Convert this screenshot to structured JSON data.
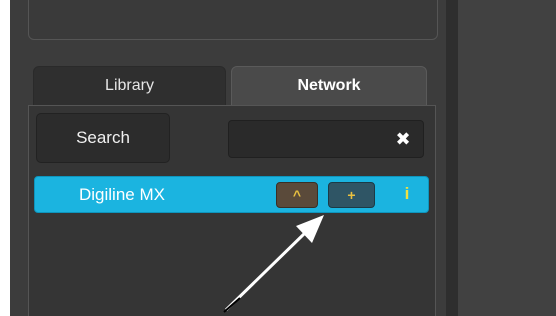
{
  "tabs": {
    "library_label": "Library",
    "network_label": "Network",
    "active": "Network"
  },
  "search": {
    "button_label": "Search",
    "input_value": "",
    "clear_glyph": "✖"
  },
  "devices": [
    {
      "name": "Digiline MX",
      "selected": true,
      "up_label": "^",
      "add_label": "+",
      "info_label": "i"
    }
  ],
  "colors": {
    "selected_row": "#1bb4e0",
    "accent_yellow": "#e8c040",
    "panel": "#3c3c3c",
    "annotation_arrow": "#ffffff"
  },
  "icons": {
    "clear": "close-icon",
    "info": "info-icon",
    "up": "chevron-up-icon",
    "add": "plus-icon",
    "annotation": "pointer-arrow-icon"
  }
}
